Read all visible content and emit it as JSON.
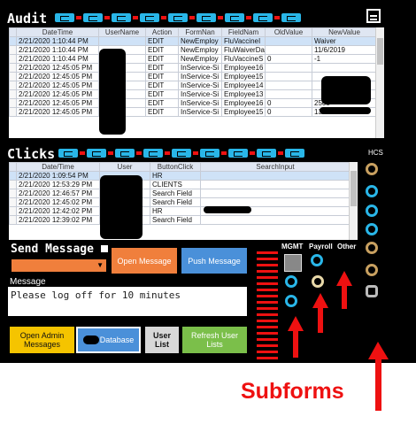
{
  "audit": {
    "title": "Audit",
    "columns": [
      "DateTime",
      "UserName",
      "Action",
      "FormNan",
      "FieldNam",
      "OldValue",
      "NewValue"
    ],
    "rows": [
      [
        "2/21/2020 1:10:44 PM",
        "",
        "EDIT",
        "NewEmploy",
        "FluVaccineI",
        "",
        "Waiver"
      ],
      [
        "2/21/2020 1:10:44 PM",
        "",
        "EDIT",
        "NewEmploy",
        "FluWaiverDa",
        "",
        "11/6/2019"
      ],
      [
        "2/21/2020 1:10:44 PM",
        "",
        "EDIT",
        "NewEmploy",
        "FluVaccineS",
        "0",
        "-1"
      ],
      [
        "2/21/2020 12:45:05 PM",
        "",
        "EDIT",
        "InService-Si",
        "Employee16",
        "",
        ""
      ],
      [
        "2/21/2020 12:45:05 PM",
        "",
        "EDIT",
        "InService-Si",
        "Employee15",
        "",
        ""
      ],
      [
        "2/21/2020 12:45:05 PM",
        "",
        "EDIT",
        "InService-Si",
        "Employee14",
        "",
        ""
      ],
      [
        "2/21/2020 12:45:05 PM",
        "",
        "EDIT",
        "InService-Si",
        "Employee13",
        "",
        ""
      ],
      [
        "2/21/2020 12:45:05 PM",
        "",
        "EDIT",
        "InService-Si",
        "Employee16",
        "0",
        "2505"
      ],
      [
        "2/21/2020 12:45:05 PM",
        "",
        "EDIT",
        "InService-Si",
        "Employee15",
        "0",
        "1316"
      ]
    ]
  },
  "clicks": {
    "title": "Clicks",
    "columns": [
      "Date/Time",
      "User",
      "ButtonClick",
      "SearchInput"
    ],
    "rows": [
      [
        "2/21/2020 1:09:54 PM",
        "",
        "HR",
        ""
      ],
      [
        "2/21/2020 12:53:29 PM",
        "",
        "CLIENTS",
        ""
      ],
      [
        "2/21/2020 12:46:57 PM",
        "",
        "Search Field",
        ""
      ],
      [
        "2/21/2020 12:45:02 PM",
        "",
        "Search Field",
        ""
      ],
      [
        "2/21/2020 12:42:02 PM",
        "",
        "HR",
        ""
      ],
      [
        "2/21/2020 12:39:02 PM",
        "",
        "Search Field",
        ""
      ]
    ]
  },
  "hcs_label": "HCS",
  "send_message": {
    "title": "Send Message",
    "open_label": "Open Message",
    "push_label": "Push Message",
    "message_label": "Message",
    "message_value": "Please log off for 10 minutes"
  },
  "buttons": {
    "open_admin": "Open Admin Messages",
    "database": "Database",
    "user_list": "User List",
    "refresh": "Refresh User Lists"
  },
  "subform_labels": {
    "mgmt": "MGMT",
    "payroll": "Payroll",
    "other": "Other"
  },
  "annotation": "Subforms",
  "colors": {
    "accent_cyan": "#29b6e8",
    "accent_red": "#e11111",
    "orange": "#f07f3c",
    "blue_btn": "#4a90d9",
    "yellow": "#f5c400",
    "green": "#7bbf4a"
  }
}
